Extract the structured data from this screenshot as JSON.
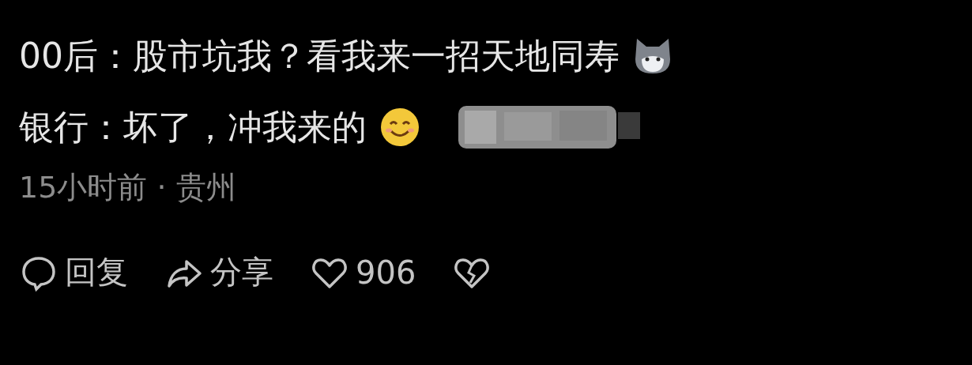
{
  "comment": {
    "lines": [
      {
        "text": "00后：股市坑我？看我来一招天地同寿",
        "emoji": {
          "kind": "cat"
        }
      },
      {
        "text": "银行：坏了，冲我来的",
        "emoji": {
          "kind": "smile"
        }
      }
    ],
    "meta": "15小时前 · 贵州",
    "actions": [
      {
        "kind": "reply",
        "label": "回复"
      },
      {
        "kind": "share",
        "label": "分享"
      },
      {
        "kind": "like",
        "label": "906"
      },
      {
        "kind": "dislike"
      }
    ]
  }
}
